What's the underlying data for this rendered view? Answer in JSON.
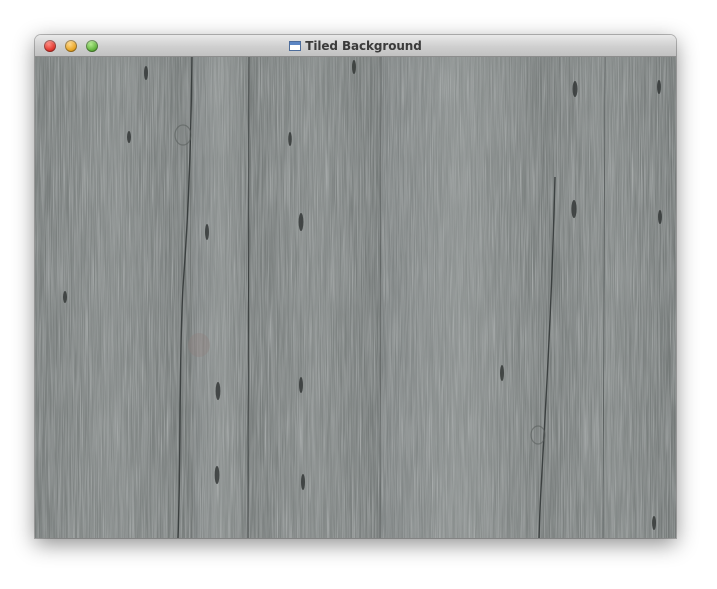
{
  "window": {
    "title": "Tiled Background",
    "title_icon": "document-window-icon",
    "buttons": [
      {
        "name": "close",
        "color": "#e0332a"
      },
      {
        "name": "minimize",
        "color": "#e8a320"
      },
      {
        "name": "zoom",
        "color": "#5fb23a"
      }
    ]
  },
  "content": {
    "texture": "weathered-gray-wood-planks",
    "base_color": "#7c8180"
  }
}
